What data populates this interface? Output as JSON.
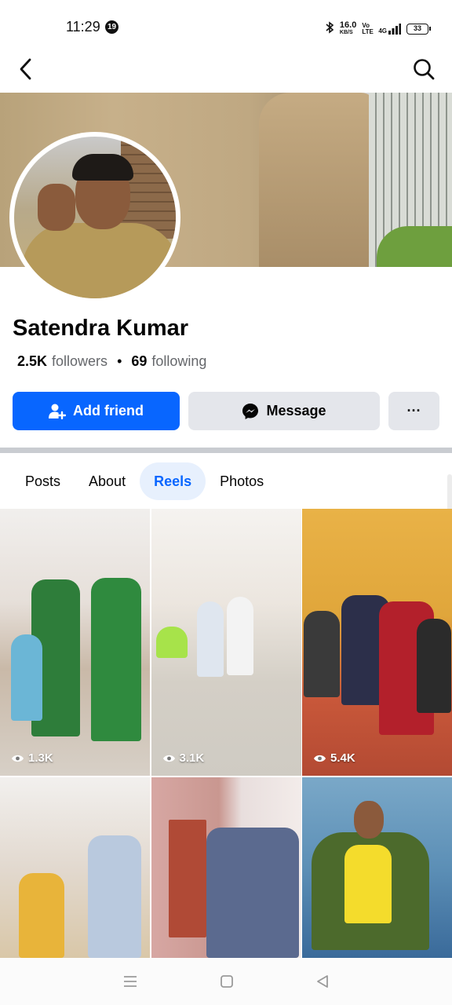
{
  "status": {
    "time": "11:29",
    "notification_count": "19",
    "network_speed_value": "16.0",
    "network_speed_unit": "KB/S",
    "volte": "Vo LTE",
    "signal": "4G",
    "battery": "33"
  },
  "profile": {
    "name": "Satendra Kumar",
    "followers_count": "2.5K",
    "followers_label": "followers",
    "following_count": "69",
    "following_label": "following",
    "separator": "•"
  },
  "actions": {
    "add_friend": "Add friend",
    "message": "Message",
    "more": "···"
  },
  "tabs": [
    {
      "label": "Posts",
      "active": false
    },
    {
      "label": "About",
      "active": false
    },
    {
      "label": "Reels",
      "active": true
    },
    {
      "label": "Photos",
      "active": false
    }
  ],
  "reels": [
    {
      "views": "1.3K"
    },
    {
      "views": "3.1K"
    },
    {
      "views": "5.4K"
    },
    {
      "views": ""
    },
    {
      "views": ""
    },
    {
      "views": ""
    }
  ],
  "icons": {
    "back": "back-arrow-icon",
    "search": "search-icon",
    "add_friend": "person-plus-icon",
    "message": "messenger-icon",
    "views": "eye-icon"
  },
  "colors": {
    "accent": "#0866ff",
    "tab_active_bg": "#e7f0fd",
    "button_secondary": "#e4e6eb"
  }
}
